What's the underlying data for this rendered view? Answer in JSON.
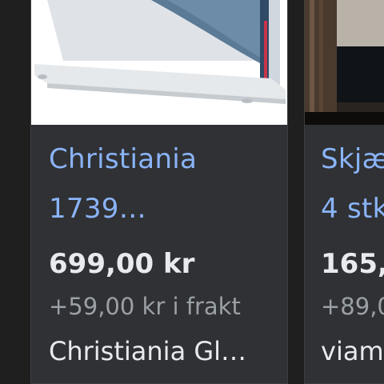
{
  "products": [
    {
      "title_line1": "Christiania",
      "title_line2": "1739…",
      "price": "699,00 kr",
      "shipping": "+59,00 kr i frakt",
      "seller": "Christiania Gl…",
      "image_icon": "knife-block-image"
    },
    {
      "title_line1": "Skjæ",
      "title_line2": "4 stk",
      "price": "165,",
      "shipping": "+89,0",
      "seller": "viam",
      "image_icon": "knife-set-image"
    }
  ],
  "colors": {
    "background": "#1f1f1f",
    "card": "#303134",
    "link": "#8ab4f8",
    "price": "#e8eaed",
    "muted": "#9aa0a6"
  }
}
